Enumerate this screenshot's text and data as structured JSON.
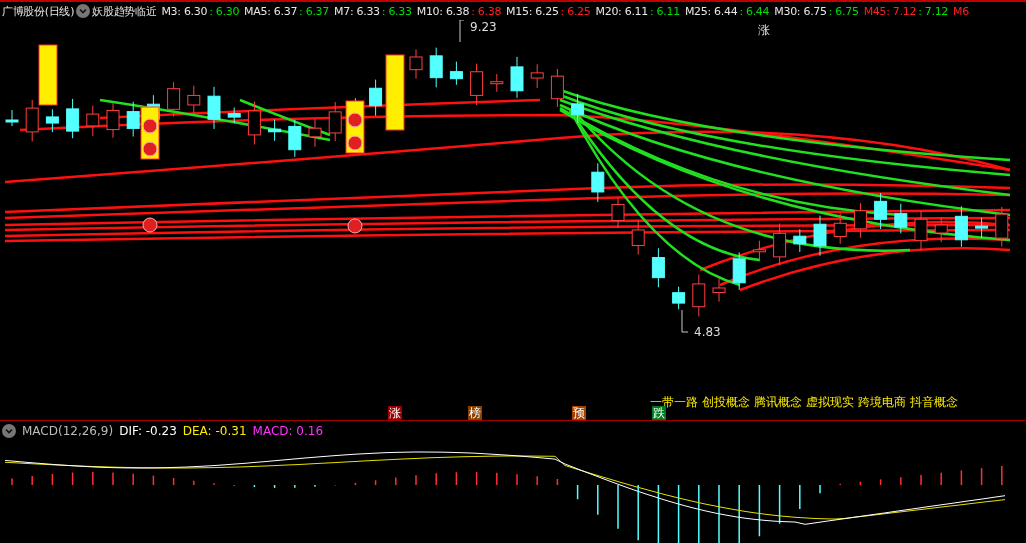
{
  "header": {
    "stock_title": "广博股份(日线)",
    "indicator": "妖股趋势临近",
    "averages": [
      {
        "label": "M3: 6.30",
        "value": ": 6.30",
        "highlighted": false,
        "color": "#00e000"
      },
      {
        "label": "MA5: 6.37",
        "value": ": 6.37",
        "highlighted": false,
        "color": "#00e000"
      },
      {
        "label": "M7: 6.33",
        "value": ": 6.33",
        "highlighted": false,
        "color": "#00e000"
      },
      {
        "label": "M10: 6.38",
        "value": ": 6.38",
        "highlighted": false,
        "color": "#ff2020"
      },
      {
        "label": "M15: 6.25",
        "value": ": 6.25",
        "highlighted": false,
        "color": "#ff2020"
      },
      {
        "label": "M20: 6.11",
        "value": ": 6.11",
        "highlighted": false,
        "color": "#00e000"
      },
      {
        "label": "M25: 6.44",
        "value": ": 6.44",
        "highlighted": false,
        "color": "#00e000"
      },
      {
        "label": "M30: 6.75",
        "value": ": 6.75",
        "highlighted": false,
        "color": "#00e000"
      },
      {
        "label": "M45: 7.12",
        "value": ": 7.12",
        "highlighted": true,
        "color": "#00e000"
      },
      {
        "label": "M6",
        "highlighted": true
      }
    ]
  },
  "price_chart": {
    "high_label": "9.23",
    "low_label": "4.83",
    "signal_label": "涨",
    "markers": [
      {
        "text": "涨",
        "color": "#9a0000"
      },
      {
        "text": "榜",
        "color": "#8a4000"
      },
      {
        "text": "预",
        "color": "#a84000"
      },
      {
        "text": "跌",
        "color": "#007a20"
      }
    ],
    "concepts": [
      "一带一路",
      "创投概念",
      "腾讯概念",
      "虚拟现实",
      "跨境电商",
      "抖音概念"
    ]
  },
  "macd": {
    "title": "MACD(12,26,9)",
    "dif": "DIF: -0.23",
    "dea": "DEA: -0.31",
    "macd": "MACD: 0.16"
  }
}
